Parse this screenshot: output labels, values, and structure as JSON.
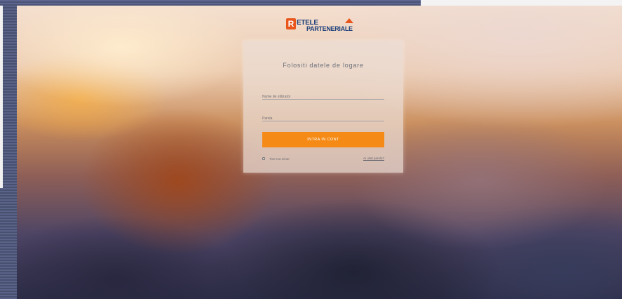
{
  "logo": {
    "mark": "R",
    "line1": "ETELE",
    "line2": "PARTENERIALE"
  },
  "login": {
    "title": "Folositi datele de logare",
    "username_placeholder": "Nume de utilizator",
    "password_placeholder": "Parola",
    "submit_label": "INTRA IN CONT",
    "remember_label": "Tine-ma minte",
    "forgot_link": "Ai uitat parola?"
  },
  "colors": {
    "accent_button": "#f58a16",
    "logo_blue": "#1d3f7a",
    "logo_orange": "#e8561b"
  }
}
